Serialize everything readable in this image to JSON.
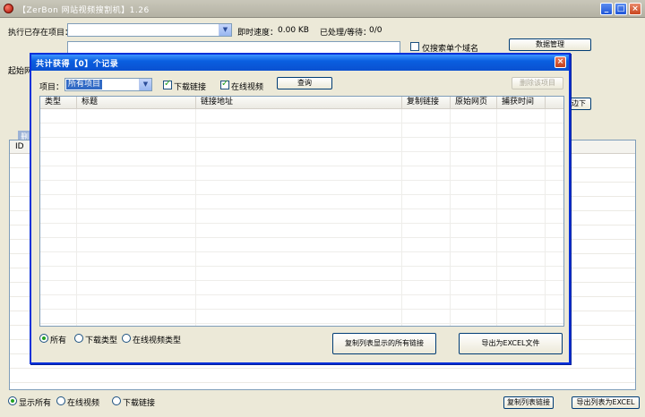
{
  "window": {
    "title": "【ZerBon 网站视频搜割机】1.26",
    "min": "_",
    "max": "□",
    "close": "×"
  },
  "top": {
    "exec_label": "执行已存在项目：",
    "speed_label": "即时速度：",
    "speed_value": "0.00 KB",
    "progress_label": "已处理/等待：",
    "progress_value": "0/0",
    "single_domain_label": "仅搜索单个域名",
    "data_manage_button": "数据管理",
    "start_label": "起始网",
    "tab_partial": "删",
    "side_button_partial": "边下"
  },
  "background_list": {
    "id_header": "ID"
  },
  "bottom": {
    "radios": [
      {
        "label": "显示所有",
        "checked": true
      },
      {
        "label": "在线视频",
        "checked": false
      },
      {
        "label": "下载链接",
        "checked": false
      }
    ],
    "copy_button": "复制列表链接",
    "export_button": "导出列表为EXCEL"
  },
  "dialog": {
    "title": "共计获得【0】个记录",
    "close": "×",
    "project_label": "项目：",
    "project_value": "所有项目",
    "download_link_label": "下载链接",
    "online_video_label": "在线视频",
    "query_button": "查询",
    "delete_button": "删除该项目",
    "columns": [
      "类型",
      "标题",
      "链接地址",
      "复制链接",
      "原始网页",
      "捕获时间"
    ],
    "filters": [
      {
        "label": "所有",
        "checked": true
      },
      {
        "label": "下载类型",
        "checked": false
      },
      {
        "label": "在线视频类型",
        "checked": false
      }
    ],
    "copy_all_button": "复制列表显示的所有链接",
    "export_excel_button": "导出为EXCEL文件"
  }
}
